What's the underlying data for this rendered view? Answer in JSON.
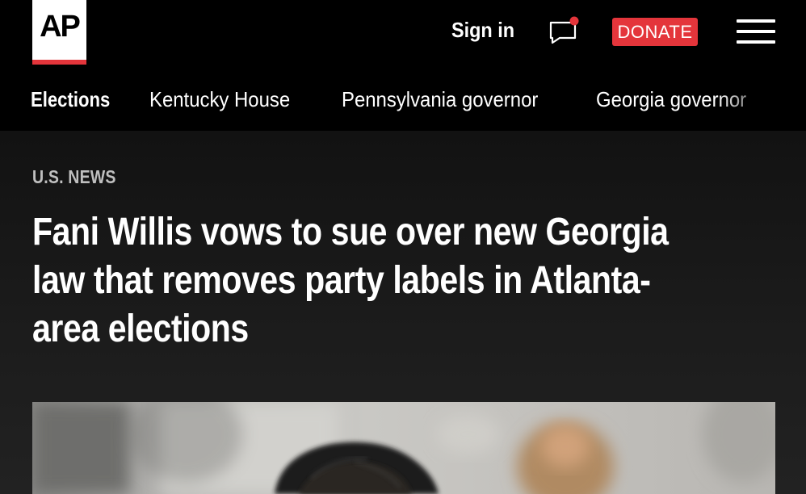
{
  "header": {
    "logo_text": "AP",
    "sign_in": "Sign in",
    "donate": "DONATE",
    "icons": [
      "chat-notification-icon",
      "menu-icon"
    ],
    "accent_color": "#e4353b"
  },
  "nav": {
    "items": [
      {
        "label": "Elections",
        "active": true
      },
      {
        "label": "Kentucky House",
        "active": false
      },
      {
        "label": "Pennsylvania governor",
        "active": false
      },
      {
        "label": "Georgia governor",
        "active": false
      }
    ]
  },
  "article": {
    "section": "U.S. NEWS",
    "headline": "Fani Willis vows to sue over new Georgia law that removes party labels in Atlanta-area elections"
  }
}
